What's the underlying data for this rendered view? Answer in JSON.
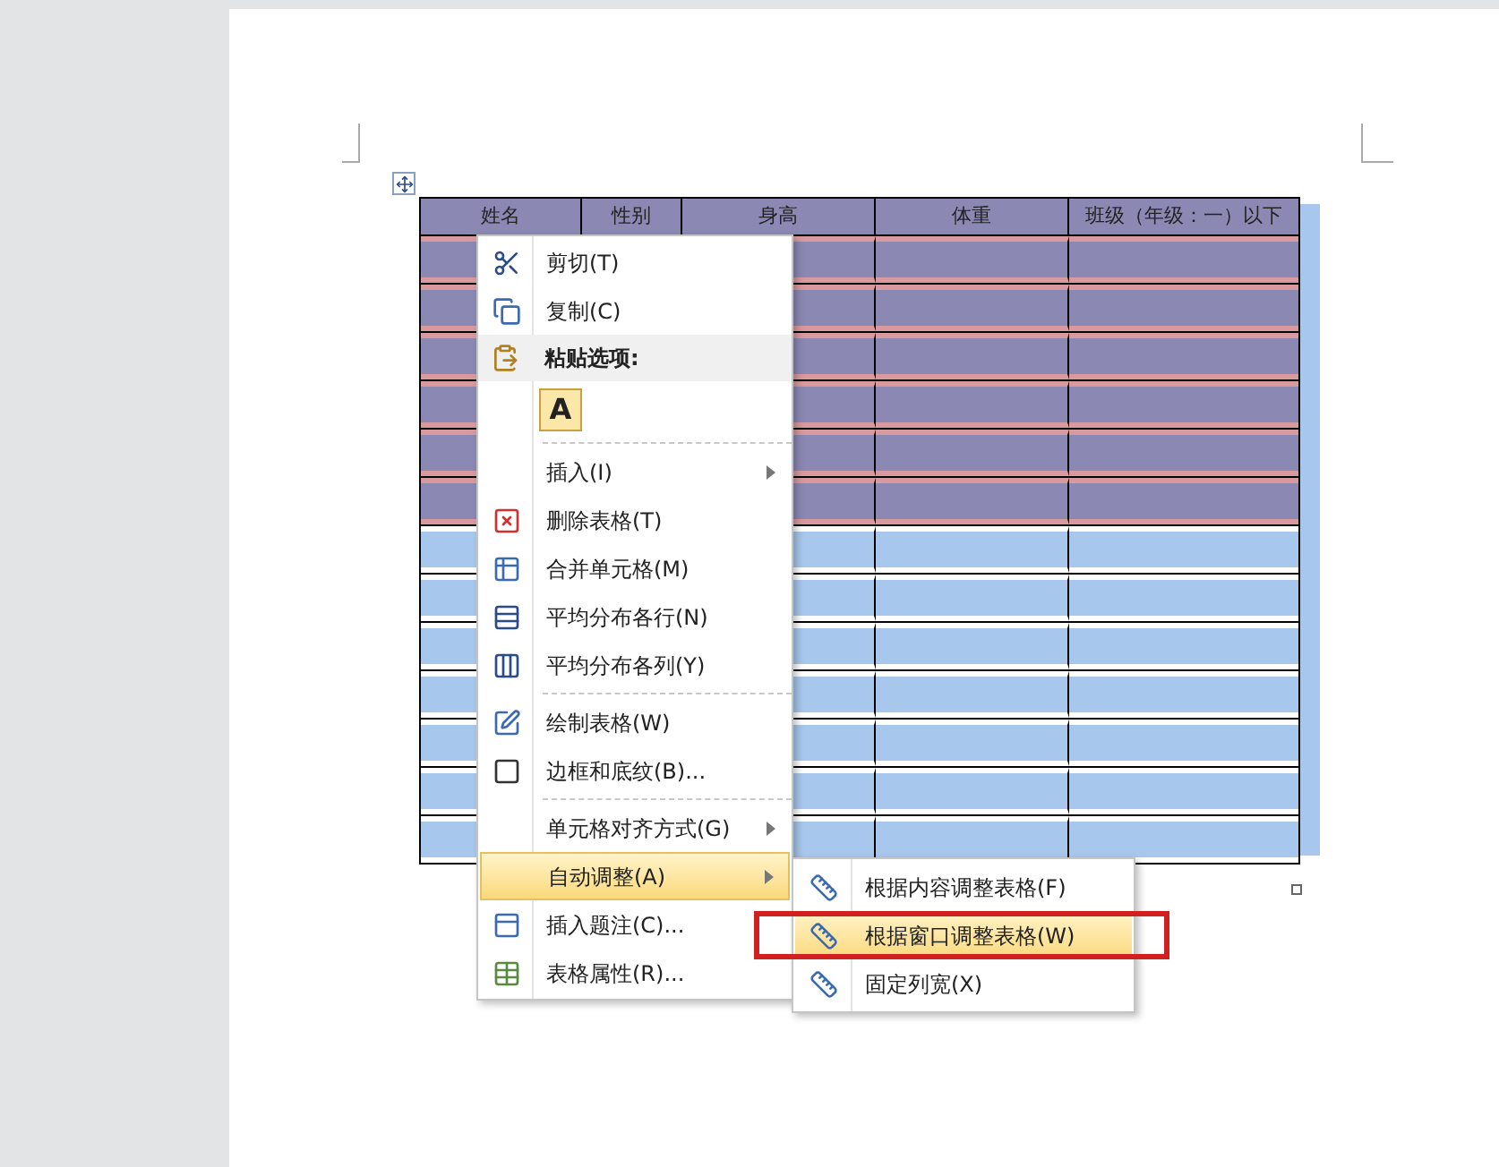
{
  "table": {
    "columns": [
      "姓名",
      "性别",
      "身高",
      "体重",
      "班级（年级：一）以下"
    ],
    "rows": [
      {
        "shaded": true
      },
      {
        "shaded": true
      },
      {
        "shaded": true
      },
      {
        "shaded": true
      },
      {
        "shaded": true
      },
      {
        "shaded": true
      },
      {
        "shaded": false
      },
      {
        "shaded": false
      },
      {
        "shaded": false
      },
      {
        "shaded": false
      },
      {
        "shaded": false
      },
      {
        "shaded": false
      },
      {
        "shaded": false
      }
    ]
  },
  "context_menu": {
    "items": [
      {
        "kind": "command",
        "label": "剪切(T)",
        "selected": false
      },
      {
        "kind": "command",
        "label": "复制(C)",
        "selected": false
      },
      {
        "kind": "header",
        "label": "粘贴选项:"
      },
      {
        "kind": "paste",
        "label": "A"
      },
      {
        "kind": "separator"
      },
      {
        "kind": "submenu",
        "label": "插入(I)",
        "selected": false
      },
      {
        "kind": "command",
        "label": "删除表格(T)",
        "selected": false
      },
      {
        "kind": "command",
        "label": "合并单元格(M)",
        "selected": false
      },
      {
        "kind": "command",
        "label": "平均分布各行(N)",
        "selected": false
      },
      {
        "kind": "command",
        "label": "平均分布各列(Y)",
        "selected": false
      },
      {
        "kind": "separator"
      },
      {
        "kind": "command",
        "label": "绘制表格(W)",
        "selected": false
      },
      {
        "kind": "command",
        "label": "边框和底纹(B)...",
        "selected": false
      },
      {
        "kind": "separator"
      },
      {
        "kind": "submenu",
        "label": "单元格对齐方式(G)",
        "selected": false
      },
      {
        "kind": "submenu",
        "label": "自动调整(A)",
        "selected": true
      },
      {
        "kind": "command",
        "label": "插入题注(C)...",
        "selected": false
      },
      {
        "kind": "command",
        "label": "表格属性(R)...",
        "selected": false
      }
    ]
  },
  "submenu": {
    "items": [
      {
        "label": "根据内容调整表格(F)",
        "selected": false,
        "outlined": false
      },
      {
        "label": "根据窗口调整表格(W)",
        "selected": true,
        "outlined": true
      },
      {
        "label": "固定列宽(X)",
        "selected": false,
        "outlined": false
      }
    ]
  }
}
